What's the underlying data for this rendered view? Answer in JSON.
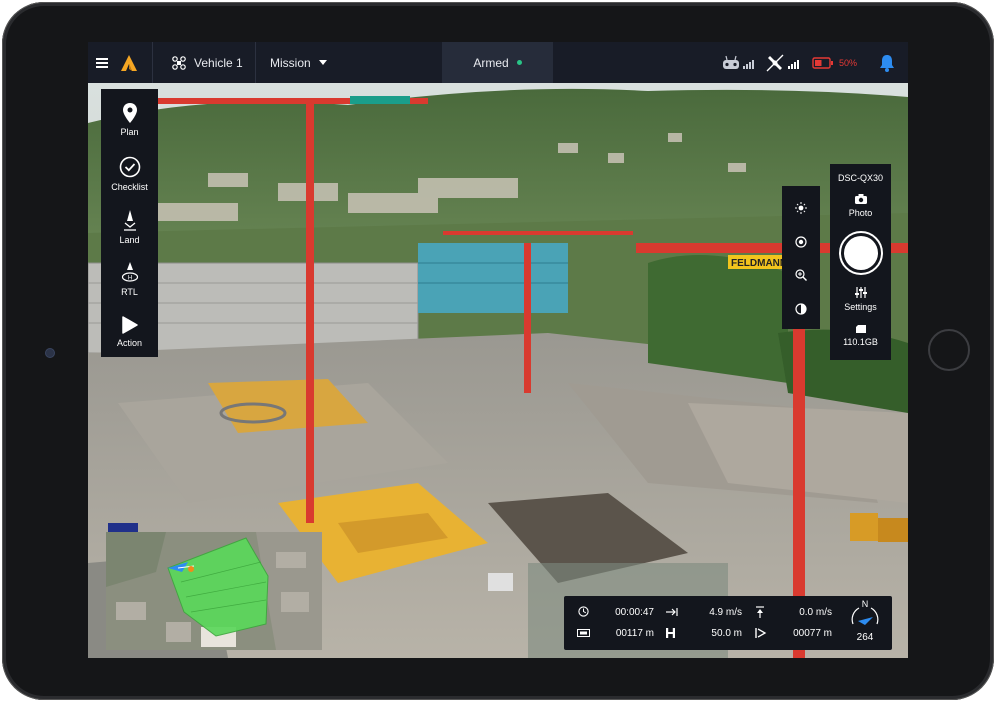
{
  "topbar": {
    "vehicle_label": "Vehicle 1",
    "mission_label": "Mission",
    "armed_label": "Armed",
    "battery_percent": "50%",
    "battery_level": 0.5
  },
  "left_panel": {
    "items": [
      {
        "label": "Plan"
      },
      {
        "label": "Checklist"
      },
      {
        "label": "Land"
      },
      {
        "label": "RTL"
      },
      {
        "label": "Action"
      }
    ]
  },
  "camera_panel": {
    "model": "DSC-QX30",
    "photo_label": "Photo",
    "settings_label": "Settings",
    "storage_label": "110.1GB"
  },
  "telemetry": {
    "flight_time": "00:00:47",
    "horizontal_speed": "4.9 m/s",
    "vertical_speed": "0.0 m/s",
    "distance": "00117 m",
    "height": "50.0 m",
    "total_distance": "00077 m",
    "heading": "264",
    "compass_label": "N"
  },
  "colors": {
    "topbar_bg": "#181c27",
    "panel_bg": "#13161d",
    "armed_dot": "#29c587",
    "battery_red": "#e53935",
    "bell_blue": "#2d8cf0",
    "logo_orange": "#f5a623",
    "geofence_green": "#5bd85b"
  }
}
